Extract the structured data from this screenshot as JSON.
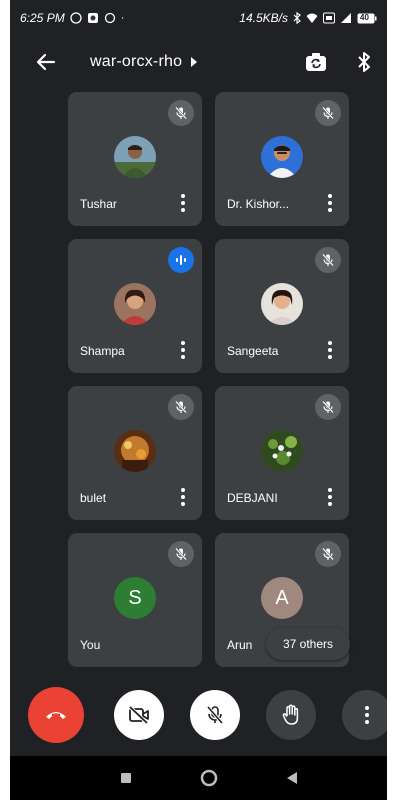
{
  "status_bar": {
    "time": "6:25 PM",
    "network_speed": "14.5KB/s",
    "battery": "40",
    "left_icons": [
      "whatsapp-icon",
      "app-icon",
      "notification-icon",
      "dot-icon"
    ],
    "right_icons": [
      "bluetooth-icon",
      "wifi-icon",
      "volte-icon",
      "signal-icon",
      "battery-icon"
    ]
  },
  "header": {
    "meeting_code": "war-orcx-rho",
    "icons": [
      "back-arrow-icon",
      "chevron-right-icon",
      "camera-switch-icon",
      "bluetooth-icon"
    ]
  },
  "participants": [
    {
      "name": "Tushar",
      "mic": "muted",
      "avatar": "photo"
    },
    {
      "name": "Dr. Kishor...",
      "mic": "muted",
      "avatar": "photo"
    },
    {
      "name": "Shampa",
      "mic": "speaking",
      "avatar": "photo"
    },
    {
      "name": "Sangeeta",
      "mic": "muted",
      "avatar": "photo"
    },
    {
      "name": "bulet",
      "mic": "muted",
      "avatar": "photo"
    },
    {
      "name": "DEBJANI",
      "mic": "muted",
      "avatar": "photo"
    },
    {
      "name": "You",
      "mic": "muted",
      "avatar_letter": "S",
      "avatar_color": "#2d7d32"
    },
    {
      "name": "Arun",
      "mic": "muted",
      "avatar_letter": "A",
      "avatar_color": "#a1887f"
    }
  ],
  "others_chip": "37 others",
  "controls": {
    "end_call": {
      "icon": "end-call-icon",
      "color": "#ea4335"
    },
    "camera": {
      "icon": "camera-off-icon",
      "color": "#ffffff"
    },
    "mic": {
      "icon": "mic-off-icon",
      "color": "#ffffff"
    },
    "raise_hand": {
      "icon": "raise-hand-icon",
      "color": "#3c4043"
    },
    "more": {
      "icon": "more-options-icon",
      "color": "#3c4043"
    }
  },
  "nav_bar": {
    "icons": [
      "recents-square-icon",
      "home-circle-icon",
      "back-triangle-icon"
    ]
  }
}
